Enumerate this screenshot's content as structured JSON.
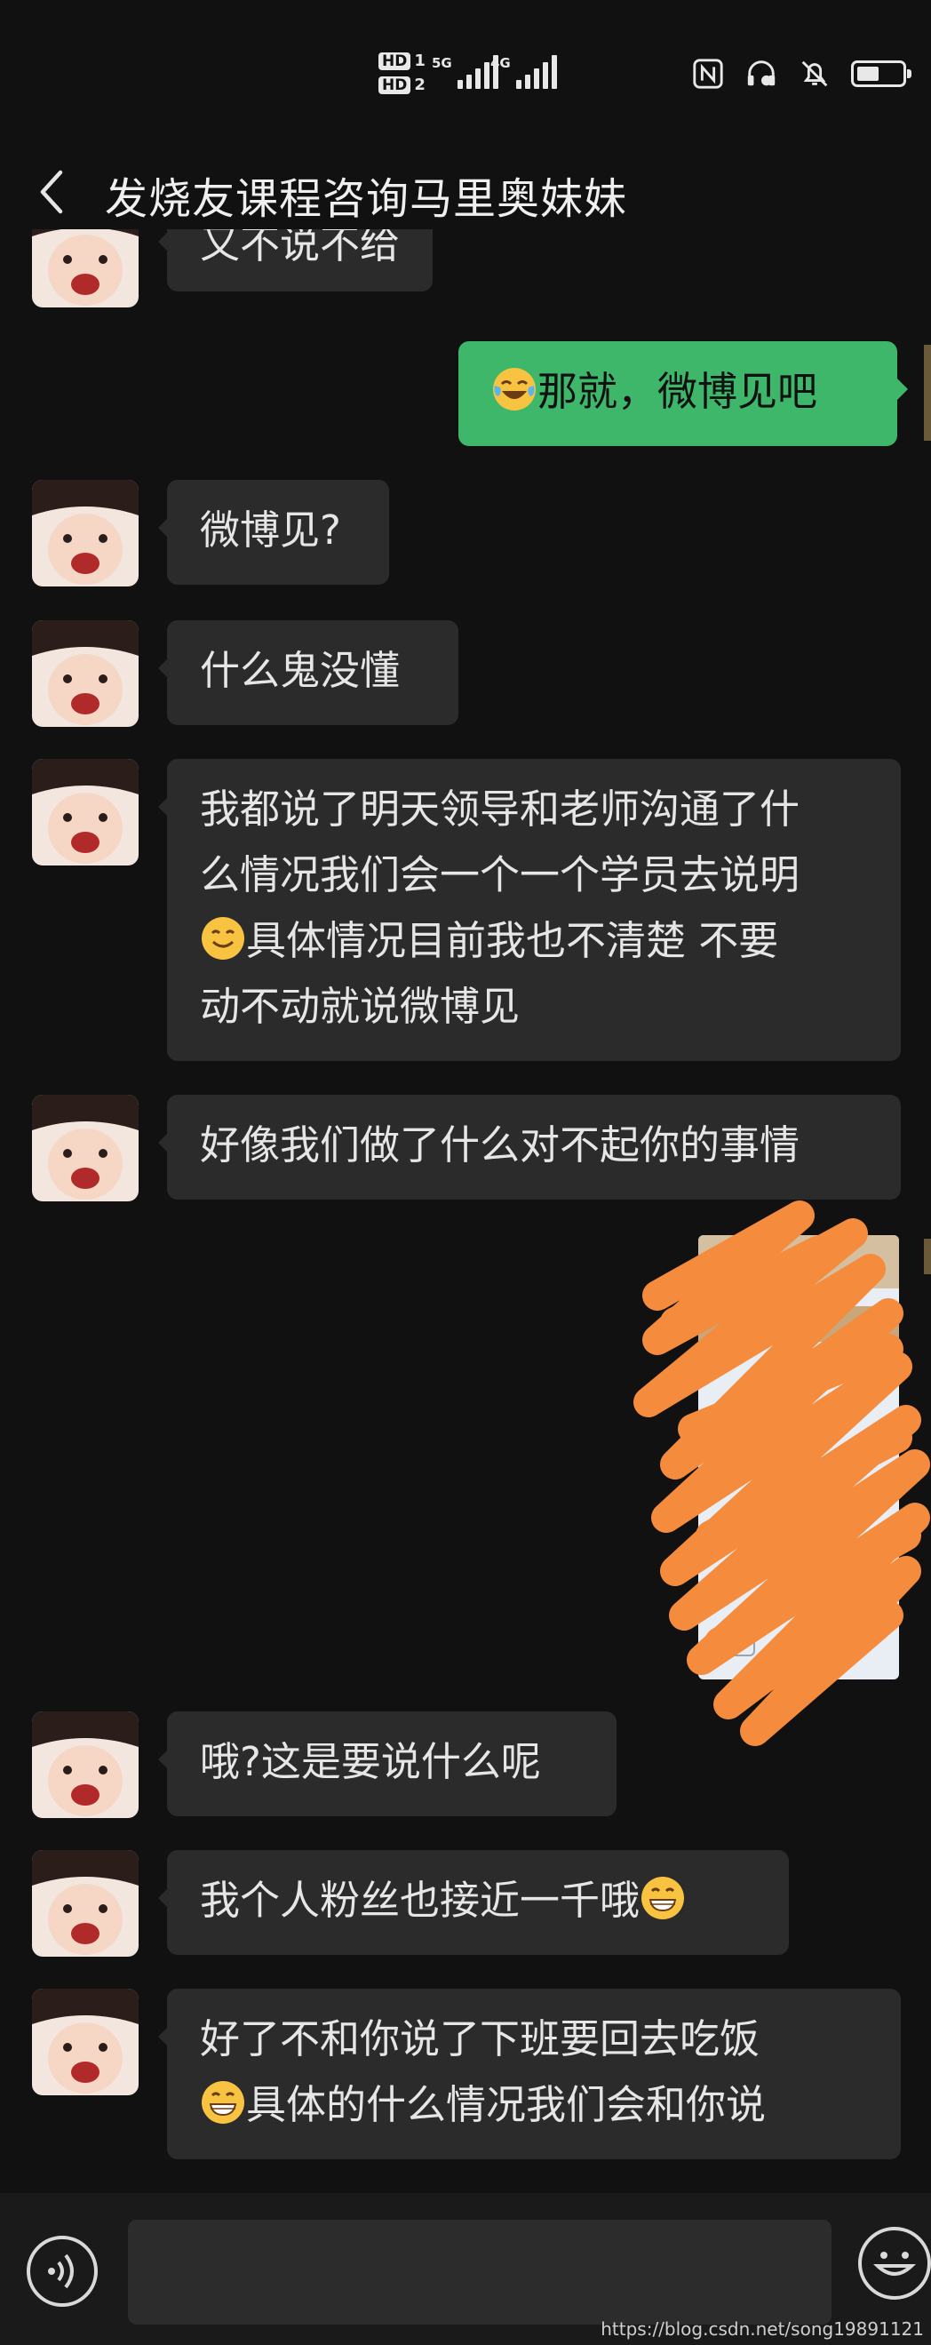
{
  "status_bar": {
    "hd1": "HD",
    "hd1_num": "1",
    "hd2": "HD",
    "hd2_num": "2",
    "sim1_label": "5G",
    "sim2_label": "4G",
    "icons": [
      "nfc-icon",
      "headset-icon",
      "mute-bell-icon",
      "battery-icon"
    ]
  },
  "header": {
    "title": "发烧友课程咨询马里奥妹妹"
  },
  "messages": [
    {
      "from": "other",
      "text": "又不说不给"
    },
    {
      "from": "me",
      "text": "那就，微博见吧",
      "emoji": "tears-of-joy"
    },
    {
      "from": "other",
      "text": "微博见?"
    },
    {
      "from": "other",
      "text": "什么鬼没懂"
    },
    {
      "from": "other",
      "line1": "我都说了明天领导和老师沟通了什",
      "line2": "么情况我们会一个一个学员去说明",
      "line3": "具体情况目前我也不清楚 不要",
      "line4": "动不动就说微博见",
      "emoji": "smile"
    },
    {
      "from": "other",
      "text": "好像我们做了什么对不起你的事情"
    },
    {
      "from": "me",
      "type": "image"
    },
    {
      "from": "other",
      "text": "哦?这是要说什么呢"
    },
    {
      "from": "other",
      "text": "我个人粉丝也接近一千哦",
      "emoji": "grin"
    },
    {
      "from": "other",
      "line1": "好了不和你说了下班要回去吃饭",
      "line2": "具体的什么情况我们会和你说",
      "emoji": "grin"
    }
  ],
  "composer": {
    "input_value": ""
  },
  "watermark": "https://blog.csdn.net/song19891121",
  "colors": {
    "background": "#111111",
    "bubble_other": "#2b2b2b",
    "bubble_mine": "#3eb76b",
    "scribble": "#f58b3c"
  }
}
